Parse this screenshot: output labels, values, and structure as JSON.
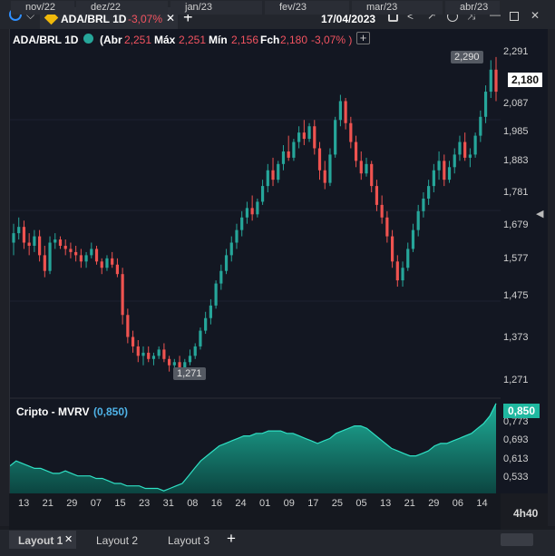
{
  "header": {
    "symbol": "ADA/BRL 1D",
    "change": "-3,07%",
    "date": "17/04/2023"
  },
  "legend": {
    "symbol": "ADA/BRL 1D",
    "open_label": "(Abr",
    "open_value": "2,251",
    "high_label": "Máx",
    "high_value": "2,251",
    "low_label": "Mín",
    "low_value": "2,156",
    "close_label": "Fch",
    "close_value": "2,180",
    "change": "-3,07% )"
  },
  "indicator": {
    "name": "Cripto - MVRV",
    "value": "(0,850)",
    "current": "0,850",
    "ticks": [
      "0,773",
      "0,693",
      "0,613",
      "0,533"
    ]
  },
  "price_axis": {
    "ticks": [
      "2,291",
      "2,189",
      "2,087",
      "1,985",
      "1,883",
      "1,781",
      "1,679",
      "1,577",
      "1,475",
      "1,373",
      "1,271"
    ],
    "current": "2,180",
    "high_marker": "2,290",
    "low_marker": "1,271"
  },
  "time_axis": {
    "days": [
      "13",
      "21",
      "29",
      "07",
      "15",
      "23",
      "31",
      "08",
      "16",
      "24",
      "01",
      "09",
      "17",
      "25",
      "05",
      "13",
      "21",
      "29",
      "06",
      "14"
    ],
    "months": [
      "nov/22",
      "dez/22",
      "jan/23",
      "fev/23",
      "mar/23",
      "abr/23"
    ],
    "corner": "4h40"
  },
  "layouts": {
    "items": [
      "Layout 1",
      "Layout 2",
      "Layout 3"
    ]
  },
  "colors": {
    "up": "#26a69a",
    "down": "#ef5350",
    "accent": "#2962ff",
    "mvrv": "#1fb8a0"
  },
  "chart_data": {
    "type": "candlestick",
    "ylim": [
      1.24,
      2.31
    ],
    "candles": [
      [
        1.7,
        1.76,
        1.66,
        1.73
      ],
      [
        1.73,
        1.78,
        1.71,
        1.75
      ],
      [
        1.75,
        1.77,
        1.68,
        1.7
      ],
      [
        1.7,
        1.73,
        1.66,
        1.69
      ],
      [
        1.69,
        1.74,
        1.67,
        1.72
      ],
      [
        1.72,
        1.74,
        1.64,
        1.66
      ],
      [
        1.66,
        1.69,
        1.59,
        1.61
      ],
      [
        1.61,
        1.72,
        1.6,
        1.7
      ],
      [
        1.7,
        1.73,
        1.68,
        1.71
      ],
      [
        1.71,
        1.72,
        1.68,
        1.69
      ],
      [
        1.69,
        1.71,
        1.66,
        1.68
      ],
      [
        1.68,
        1.7,
        1.65,
        1.67
      ],
      [
        1.67,
        1.69,
        1.64,
        1.66
      ],
      [
        1.66,
        1.68,
        1.62,
        1.64
      ],
      [
        1.64,
        1.67,
        1.62,
        1.66
      ],
      [
        1.66,
        1.7,
        1.65,
        1.68
      ],
      [
        1.68,
        1.69,
        1.63,
        1.64
      ],
      [
        1.64,
        1.65,
        1.6,
        1.62
      ],
      [
        1.62,
        1.66,
        1.61,
        1.65
      ],
      [
        1.65,
        1.67,
        1.62,
        1.63
      ],
      [
        1.63,
        1.65,
        1.59,
        1.6
      ],
      [
        1.6,
        1.62,
        1.44,
        1.47
      ],
      [
        1.47,
        1.49,
        1.38,
        1.4
      ],
      [
        1.4,
        1.42,
        1.35,
        1.37
      ],
      [
        1.37,
        1.39,
        1.32,
        1.34
      ],
      [
        1.34,
        1.37,
        1.31,
        1.35
      ],
      [
        1.35,
        1.37,
        1.32,
        1.33
      ],
      [
        1.33,
        1.35,
        1.31,
        1.34
      ],
      [
        1.34,
        1.37,
        1.33,
        1.36
      ],
      [
        1.36,
        1.38,
        1.32,
        1.33
      ],
      [
        1.33,
        1.34,
        1.29,
        1.31
      ],
      [
        1.31,
        1.33,
        1.28,
        1.32
      ],
      [
        1.32,
        1.34,
        1.29,
        1.3
      ],
      [
        1.3,
        1.33,
        1.29,
        1.32
      ],
      [
        1.32,
        1.36,
        1.31,
        1.34
      ],
      [
        1.34,
        1.38,
        1.33,
        1.37
      ],
      [
        1.37,
        1.43,
        1.36,
        1.42
      ],
      [
        1.42,
        1.48,
        1.41,
        1.46
      ],
      [
        1.46,
        1.52,
        1.44,
        1.5
      ],
      [
        1.5,
        1.58,
        1.49,
        1.57
      ],
      [
        1.57,
        1.63,
        1.55,
        1.61
      ],
      [
        1.61,
        1.68,
        1.6,
        1.66
      ],
      [
        1.66,
        1.72,
        1.64,
        1.7
      ],
      [
        1.7,
        1.76,
        1.68,
        1.74
      ],
      [
        1.74,
        1.8,
        1.72,
        1.78
      ],
      [
        1.78,
        1.83,
        1.76,
        1.81
      ],
      [
        1.81,
        1.85,
        1.77,
        1.79
      ],
      [
        1.79,
        1.84,
        1.78,
        1.83
      ],
      [
        1.83,
        1.9,
        1.82,
        1.88
      ],
      [
        1.88,
        1.95,
        1.86,
        1.93
      ],
      [
        1.93,
        1.97,
        1.88,
        1.9
      ],
      [
        1.9,
        1.96,
        1.89,
        1.95
      ],
      [
        1.95,
        2.01,
        1.93,
        1.99
      ],
      [
        1.99,
        2.04,
        1.96,
        1.97
      ],
      [
        1.97,
        2.03,
        1.96,
        2.02
      ],
      [
        2.02,
        2.07,
        2.0,
        2.05
      ],
      [
        2.05,
        2.09,
        2.01,
        2.03
      ],
      [
        2.03,
        2.08,
        2.02,
        2.07
      ],
      [
        2.07,
        2.09,
        1.98,
        2.0
      ],
      [
        2.0,
        2.02,
        1.9,
        1.93
      ],
      [
        1.93,
        1.96,
        1.87,
        1.89
      ],
      [
        1.89,
        2.0,
        1.88,
        1.98
      ],
      [
        1.98,
        2.1,
        1.97,
        2.09
      ],
      [
        2.09,
        2.17,
        2.07,
        2.15
      ],
      [
        2.15,
        2.16,
        2.06,
        2.08
      ],
      [
        2.08,
        2.1,
        2.0,
        2.02
      ],
      [
        2.02,
        2.04,
        1.94,
        1.96
      ],
      [
        1.96,
        1.99,
        1.9,
        1.92
      ],
      [
        1.92,
        1.97,
        1.91,
        1.95
      ],
      [
        1.95,
        1.96,
        1.86,
        1.88
      ],
      [
        1.88,
        1.9,
        1.8,
        1.82
      ],
      [
        1.82,
        1.85,
        1.76,
        1.78
      ],
      [
        1.78,
        1.8,
        1.7,
        1.72
      ],
      [
        1.72,
        1.74,
        1.62,
        1.64
      ],
      [
        1.64,
        1.66,
        1.56,
        1.58
      ],
      [
        1.58,
        1.64,
        1.56,
        1.62
      ],
      [
        1.62,
        1.7,
        1.61,
        1.68
      ],
      [
        1.68,
        1.76,
        1.67,
        1.74
      ],
      [
        1.74,
        1.82,
        1.72,
        1.8
      ],
      [
        1.8,
        1.86,
        1.78,
        1.84
      ],
      [
        1.84,
        1.9,
        1.82,
        1.88
      ],
      [
        1.88,
        1.95,
        1.86,
        1.93
      ],
      [
        1.93,
        1.99,
        1.9,
        1.96
      ],
      [
        1.96,
        1.98,
        1.88,
        1.9
      ],
      [
        1.9,
        1.96,
        1.89,
        1.94
      ],
      [
        1.94,
        2.0,
        1.92,
        1.98
      ],
      [
        1.98,
        2.04,
        1.96,
        2.02
      ],
      [
        2.02,
        2.05,
        1.96,
        1.97
      ],
      [
        1.97,
        2.0,
        1.94,
        1.98
      ],
      [
        1.98,
        2.05,
        1.97,
        2.04
      ],
      [
        2.04,
        2.12,
        2.02,
        2.1
      ],
      [
        2.1,
        2.2,
        2.08,
        2.18
      ],
      [
        2.18,
        2.28,
        2.16,
        2.25
      ],
      [
        2.25,
        2.29,
        2.15,
        2.18
      ]
    ],
    "mvrv": {
      "ylim": [
        0.49,
        0.86
      ],
      "values": [
        0.6,
        0.62,
        0.61,
        0.6,
        0.59,
        0.59,
        0.58,
        0.57,
        0.57,
        0.58,
        0.57,
        0.56,
        0.56,
        0.56,
        0.55,
        0.55,
        0.54,
        0.53,
        0.53,
        0.52,
        0.52,
        0.52,
        0.51,
        0.51,
        0.51,
        0.5,
        0.51,
        0.52,
        0.53,
        0.56,
        0.59,
        0.62,
        0.64,
        0.66,
        0.68,
        0.69,
        0.7,
        0.71,
        0.72,
        0.72,
        0.73,
        0.73,
        0.74,
        0.74,
        0.74,
        0.73,
        0.73,
        0.72,
        0.71,
        0.7,
        0.69,
        0.7,
        0.71,
        0.73,
        0.74,
        0.75,
        0.76,
        0.76,
        0.75,
        0.73,
        0.71,
        0.69,
        0.67,
        0.66,
        0.65,
        0.64,
        0.64,
        0.65,
        0.66,
        0.68,
        0.69,
        0.69,
        0.7,
        0.71,
        0.72,
        0.73,
        0.75,
        0.77,
        0.8,
        0.85
      ]
    }
  }
}
